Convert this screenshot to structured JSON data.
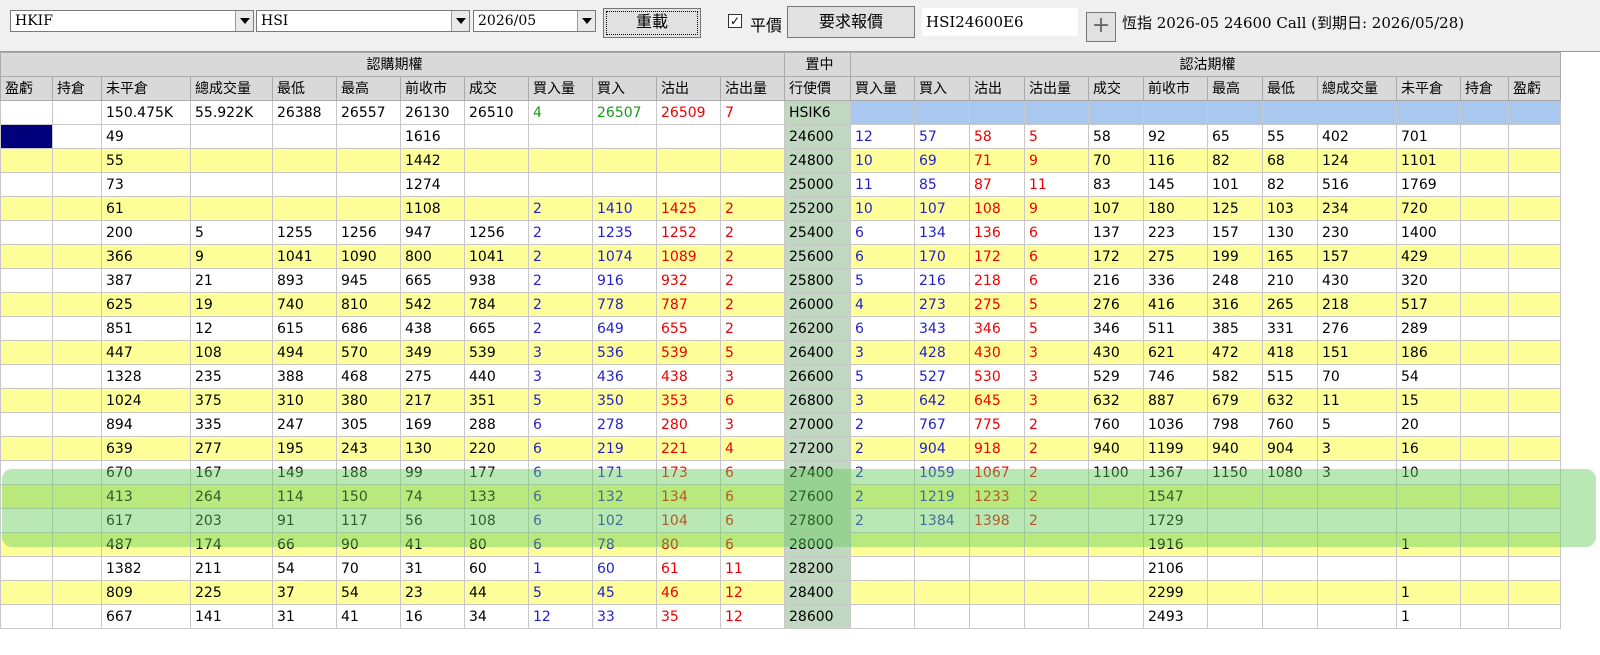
{
  "toolbar": {
    "exchange": "HKIF",
    "product": "HSI",
    "month": "2026/05",
    "reload_label": "重載",
    "par_checked_glyph": "✓",
    "par_label": "平價",
    "request_quote_label": "要求報價",
    "code_value": "HSI24600E6",
    "add_glyph": "+",
    "description": "恆指 2026-05 24600 Call (到期日: 2026/05/28)"
  },
  "grid": {
    "call_group": "認購期權",
    "center_group": "置中",
    "put_group": "認沽期權",
    "call_headers": [
      "盈虧",
      "持倉",
      "未平倉",
      "總成交量",
      "最低",
      "最高",
      "前收市",
      "成交",
      "買入量",
      "買入",
      "沽出",
      "沽出量"
    ],
    "center_header": "行使價",
    "put_headers": [
      "買入量",
      "買入",
      "沽出",
      "沽出量",
      "成交",
      "前收市",
      "最高",
      "最低",
      "總成交量",
      "未平倉",
      "持倉",
      "盈虧"
    ],
    "underlying": {
      "cells": [
        "",
        "",
        "150.475K",
        "55.922K",
        "26388",
        "26557",
        "26130",
        "26510",
        "4",
        "26507",
        "26509",
        "7"
      ],
      "code": "HSIK6"
    },
    "rows": [
      {
        "strike": "24600",
        "call": [
          "",
          "",
          "49",
          "",
          "",
          "",
          "1616",
          "",
          "",
          "",
          "",
          ""
        ],
        "put": [
          "12",
          "57",
          "58",
          "5",
          "58",
          "92",
          "65",
          "55",
          "402",
          "701",
          "",
          ""
        ]
      },
      {
        "strike": "24800",
        "call": [
          "",
          "",
          "55",
          "",
          "",
          "",
          "1442",
          "",
          "",
          "",
          "",
          ""
        ],
        "put": [
          "10",
          "69",
          "71",
          "9",
          "70",
          "116",
          "82",
          "68",
          "124",
          "1101",
          "",
          ""
        ]
      },
      {
        "strike": "25000",
        "call": [
          "",
          "",
          "73",
          "",
          "",
          "",
          "1274",
          "",
          "",
          "",
          "",
          ""
        ],
        "put": [
          "11",
          "85",
          "87",
          "11",
          "83",
          "145",
          "101",
          "82",
          "516",
          "1769",
          "",
          ""
        ]
      },
      {
        "strike": "25200",
        "call": [
          "",
          "",
          "61",
          "",
          "",
          "",
          "1108",
          "",
          "2",
          "1410",
          "1425",
          "2"
        ],
        "put": [
          "10",
          "107",
          "108",
          "9",
          "107",
          "180",
          "125",
          "103",
          "234",
          "720",
          "",
          ""
        ]
      },
      {
        "strike": "25400",
        "call": [
          "",
          "",
          "200",
          "5",
          "1255",
          "1256",
          "947",
          "1256",
          "2",
          "1235",
          "1252",
          "2"
        ],
        "put": [
          "6",
          "134",
          "136",
          "6",
          "137",
          "223",
          "157",
          "130",
          "230",
          "1400",
          "",
          ""
        ]
      },
      {
        "strike": "25600",
        "call": [
          "",
          "",
          "366",
          "9",
          "1041",
          "1090",
          "800",
          "1041",
          "2",
          "1074",
          "1089",
          "2"
        ],
        "put": [
          "6",
          "170",
          "172",
          "6",
          "172",
          "275",
          "199",
          "165",
          "157",
          "429",
          "",
          ""
        ]
      },
      {
        "strike": "25800",
        "call": [
          "",
          "",
          "387",
          "21",
          "893",
          "945",
          "665",
          "938",
          "2",
          "916",
          "932",
          "2"
        ],
        "put": [
          "5",
          "216",
          "218",
          "6",
          "216",
          "336",
          "248",
          "210",
          "430",
          "320",
          "",
          ""
        ]
      },
      {
        "strike": "26000",
        "call": [
          "",
          "",
          "625",
          "19",
          "740",
          "810",
          "542",
          "784",
          "2",
          "778",
          "787",
          "2"
        ],
        "put": [
          "4",
          "273",
          "275",
          "5",
          "276",
          "416",
          "316",
          "265",
          "218",
          "517",
          "",
          ""
        ]
      },
      {
        "strike": "26200",
        "call": [
          "",
          "",
          "851",
          "12",
          "615",
          "686",
          "438",
          "665",
          "2",
          "649",
          "655",
          "2"
        ],
        "put": [
          "6",
          "343",
          "346",
          "5",
          "346",
          "511",
          "385",
          "331",
          "276",
          "289",
          "",
          ""
        ]
      },
      {
        "strike": "26400",
        "call": [
          "",
          "",
          "447",
          "108",
          "494",
          "570",
          "349",
          "539",
          "3",
          "536",
          "539",
          "5"
        ],
        "put": [
          "3",
          "428",
          "430",
          "3",
          "430",
          "621",
          "472",
          "418",
          "151",
          "186",
          "",
          ""
        ]
      },
      {
        "strike": "26600",
        "call": [
          "",
          "",
          "1328",
          "235",
          "388",
          "468",
          "275",
          "440",
          "3",
          "436",
          "438",
          "3"
        ],
        "put": [
          "5",
          "527",
          "530",
          "3",
          "529",
          "746",
          "582",
          "515",
          "70",
          "54",
          "",
          ""
        ]
      },
      {
        "strike": "26800",
        "call": [
          "",
          "",
          "1024",
          "375",
          "310",
          "380",
          "217",
          "351",
          "5",
          "350",
          "353",
          "6"
        ],
        "put": [
          "3",
          "642",
          "645",
          "3",
          "632",
          "887",
          "679",
          "632",
          "11",
          "15",
          "",
          ""
        ]
      },
      {
        "strike": "27000",
        "call": [
          "",
          "",
          "894",
          "335",
          "247",
          "305",
          "169",
          "288",
          "6",
          "278",
          "280",
          "3"
        ],
        "put": [
          "2",
          "767",
          "775",
          "2",
          "760",
          "1036",
          "798",
          "760",
          "5",
          "20",
          "",
          ""
        ]
      },
      {
        "strike": "27200",
        "call": [
          "",
          "",
          "639",
          "277",
          "195",
          "243",
          "130",
          "220",
          "6",
          "219",
          "221",
          "4"
        ],
        "put": [
          "2",
          "904",
          "918",
          "2",
          "940",
          "1199",
          "940",
          "904",
          "3",
          "16",
          "",
          ""
        ]
      },
      {
        "strike": "27400",
        "call": [
          "",
          "",
          "670",
          "167",
          "149",
          "188",
          "99",
          "177",
          "6",
          "171",
          "173",
          "6"
        ],
        "put": [
          "2",
          "1059",
          "1067",
          "2",
          "1100",
          "1367",
          "1150",
          "1080",
          "3",
          "10",
          "",
          ""
        ]
      },
      {
        "strike": "27600",
        "call": [
          "",
          "",
          "413",
          "264",
          "114",
          "150",
          "74",
          "133",
          "6",
          "132",
          "134",
          "6"
        ],
        "put": [
          "2",
          "1219",
          "1233",
          "2",
          "",
          "1547",
          "",
          "",
          "",
          "",
          "",
          ""
        ]
      },
      {
        "strike": "27800",
        "call": [
          "",
          "",
          "617",
          "203",
          "91",
          "117",
          "56",
          "108",
          "6",
          "102",
          "104",
          "6"
        ],
        "put": [
          "2",
          "1384",
          "1398",
          "2",
          "",
          "1729",
          "",
          "",
          "",
          "",
          "",
          ""
        ]
      },
      {
        "strike": "28000",
        "call": [
          "",
          "",
          "487",
          "174",
          "66",
          "90",
          "41",
          "80",
          "6",
          "78",
          "80",
          "6"
        ],
        "put": [
          "",
          "",
          "",
          "",
          "",
          "1916",
          "",
          "",
          "",
          "1",
          "",
          ""
        ]
      },
      {
        "strike": "28200",
        "call": [
          "",
          "",
          "1382",
          "211",
          "54",
          "70",
          "31",
          "60",
          "1",
          "60",
          "61",
          "11"
        ],
        "put": [
          "",
          "",
          "",
          "",
          "",
          "2106",
          "",
          "",
          "",
          "",
          "",
          ""
        ]
      },
      {
        "strike": "28400",
        "call": [
          "",
          "",
          "809",
          "225",
          "37",
          "54",
          "23",
          "44",
          "5",
          "45",
          "46",
          "12"
        ],
        "put": [
          "",
          "",
          "",
          "",
          "",
          "2299",
          "",
          "",
          "",
          "1",
          "",
          ""
        ]
      },
      {
        "strike": "28600",
        "call": [
          "",
          "",
          "667",
          "141",
          "31",
          "41",
          "16",
          "34",
          "12",
          "33",
          "35",
          "12"
        ],
        "put": [
          "",
          "",
          "",
          "",
          "",
          "2493",
          "",
          "",
          "",
          "1",
          "",
          ""
        ]
      }
    ]
  },
  "colors": {
    "row_yellow": "#ffff99",
    "strike_col": "#c0d8c0",
    "bid_text": "#2222cc",
    "ask_text": "#ee0000",
    "top_bid_text": "#1a9a1a",
    "highlight": "#64cd5a"
  }
}
